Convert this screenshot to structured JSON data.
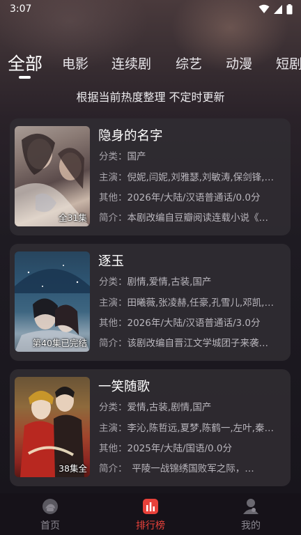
{
  "status_bar": {
    "time": "3:07"
  },
  "tabs": [
    {
      "label": "全部",
      "active": true
    },
    {
      "label": "电影"
    },
    {
      "label": "连续剧"
    },
    {
      "label": "综艺"
    },
    {
      "label": "动漫"
    },
    {
      "label": "短剧"
    }
  ],
  "subtitle": "根据当前热度整理 不定时更新",
  "items": [
    {
      "title": "隐身的名字",
      "category_label": "分类：",
      "category": "国产",
      "cast_label": "主演：",
      "cast": "倪妮,闫妮,刘雅瑟,刘敏涛,保剑锋,…",
      "other_label": "其他：",
      "other": "2026年/大陆/汉语普通话/0.0分",
      "intro_label": "简介：",
      "intro": "本剧改编自豆瓣阅读连载小说《…",
      "badge": "全31集"
    },
    {
      "title": "逐玉",
      "category_label": "分类：",
      "category": "剧情,爱情,古装,国产",
      "cast_label": "主演：",
      "cast": "田曦薇,张凌赫,任豪,孔雪儿,邓凯,…",
      "other_label": "其他：",
      "other": "2026年/大陆/汉语普通话/3.0分",
      "intro_label": "简介：",
      "intro": "该剧改编自晋江文学城团子来袭…",
      "badge": "第40集已完结"
    },
    {
      "title": "一笑随歌",
      "category_label": "分类：",
      "category": "爱情,古装,剧情,国产",
      "cast_label": "主演：",
      "cast": "李沁,陈哲远,夏梦,陈鹤一,左叶,秦…",
      "other_label": "其他：",
      "other": "2025年/大陆/国语/0.0分",
      "intro_label": "简介：",
      "intro": "　平陵一战锦绣国败军之际，…",
      "badge": "38集全"
    }
  ],
  "bottom_nav": [
    {
      "label": "首页",
      "icon": "home-icon"
    },
    {
      "label": "排行榜",
      "icon": "ranking-icon",
      "active": true
    },
    {
      "label": "我的",
      "icon": "profile-icon"
    }
  ],
  "colors": {
    "accent": "#e8413a",
    "card": "#302c32",
    "background": "#17141b"
  }
}
